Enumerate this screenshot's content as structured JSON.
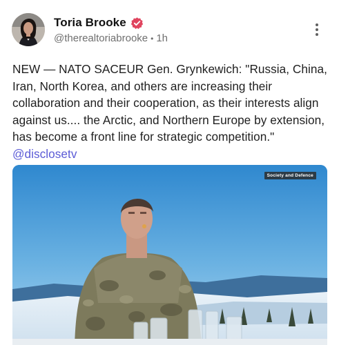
{
  "post": {
    "author": {
      "display_name": "Toria Brooke",
      "handle": "@therealtoriabrooke",
      "verified": true,
      "avatar_icon": "user-avatar",
      "verified_icon": "verified-badge-icon",
      "verified_color": "#e0455f"
    },
    "timestamp": "1h",
    "more_icon": "more-vertical-icon",
    "text": "NEW — NATO SACEUR Gen. Grynkewich: \"Russia, China, Iran, North Korea, and others are increasing their collaboration and their cooperation, as their interests align against us.... the Arctic, and Northern Europe by extension, has become a front line for strategic competition.\"",
    "mention": "@disclosetv",
    "mention_color": "#5b5bd6",
    "media": {
      "type": "video-still",
      "overlay_label": "Society and Defence"
    }
  }
}
